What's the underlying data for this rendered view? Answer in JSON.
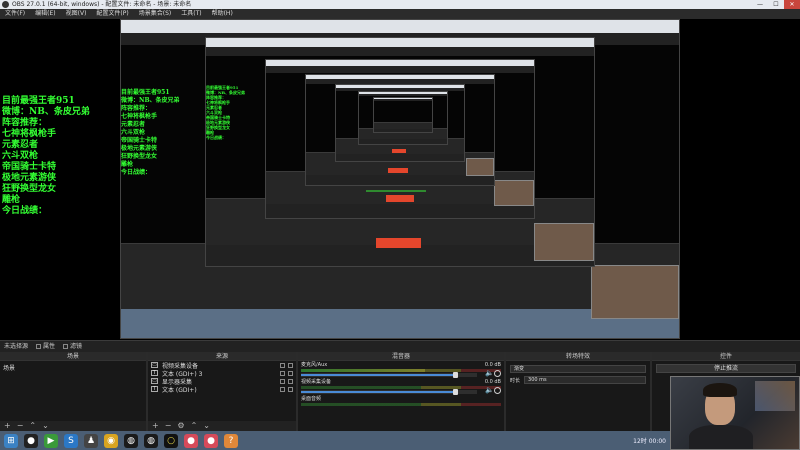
{
  "window": {
    "title": "OBS 27.0.1 (64-bit, windows) - 配置文件: 未命名 - 场景: 未命名",
    "controls": [
      "—",
      "☐",
      "✕"
    ]
  },
  "menu": [
    "文件(F)",
    "编辑(E)",
    "视图(V)",
    "配置文件(P)",
    "场景集合(S)",
    "工具(T)",
    "帮助(H)"
  ],
  "overlay": {
    "lines": [
      "目前最强王者951",
      "微博：NB、条皮兄弟",
      "阵容推荐：",
      "七神将枫枪手",
      "元素忍者",
      "六斗双枪",
      "帝国骑士卡特",
      "极地元素游侠",
      "狂野换型龙女",
      "雕枪",
      "今日战绩："
    ]
  },
  "status": {
    "label": "未选择源",
    "properties": "属性",
    "filters": "滤镜"
  },
  "scenes": {
    "header": "场景",
    "items": [
      "场景"
    ]
  },
  "sources": {
    "header": "来源",
    "items": [
      {
        "icon": "▭",
        "label": "视频采集设备"
      },
      {
        "icon": "T",
        "label": "文本 (GDI+) 3"
      },
      {
        "icon": "▭",
        "label": "显示器采集"
      },
      {
        "icon": "T",
        "label": "文本 (GDI+)"
      }
    ]
  },
  "mixer": {
    "header": "混音器",
    "channels": [
      {
        "name": "麦克风/Aux",
        "db": "0.0 dB",
        "level": 0.62,
        "volume": 0.88
      },
      {
        "name": "视频采集设备",
        "db": "0.0 dB",
        "level": 0.0,
        "volume": 0.88
      },
      {
        "name": "桌面音频",
        "db": "",
        "level": 0.0,
        "volume": 0.88
      }
    ]
  },
  "transitions": {
    "header": "转场特效",
    "selected": "渐变",
    "duration_label": "时长",
    "duration_value": "300 ms"
  },
  "controls": {
    "header": "控件",
    "stop_stream": "停止推流"
  },
  "taskbar": {
    "clock": "12时 00:00"
  },
  "colors": {
    "overlay_text": "#33ff33",
    "stream_button": "#e4462c",
    "taskbar": "#4b5e74"
  }
}
